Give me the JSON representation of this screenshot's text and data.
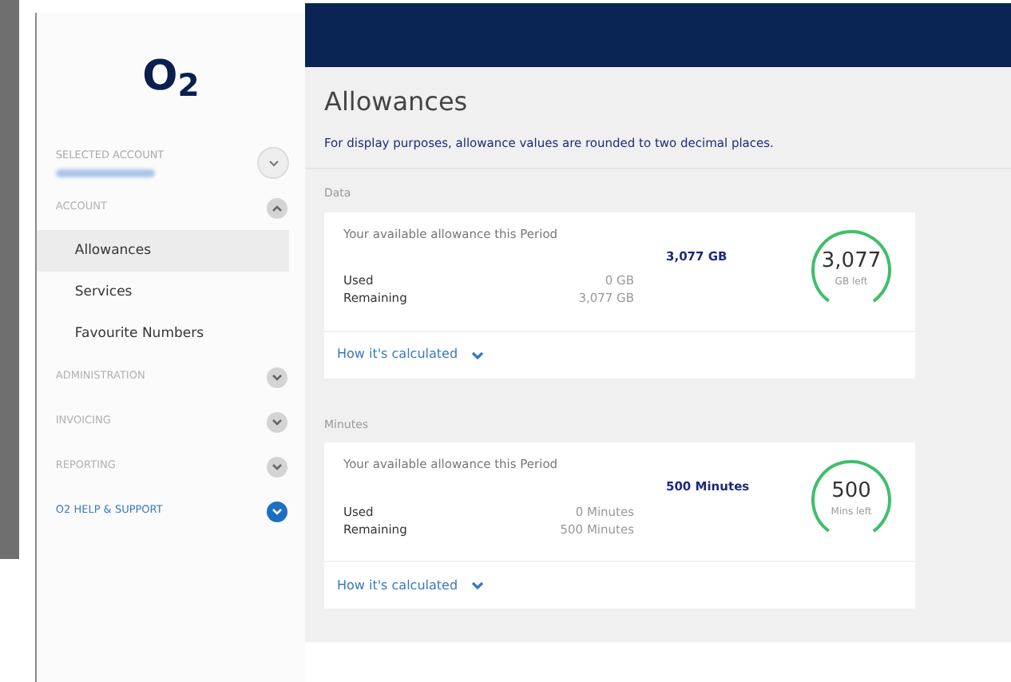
{
  "logo": "O$_{2}$",
  "selected_account": {
    "label": "SELECTED ACCOUNT"
  },
  "sections": [
    {
      "label": "ACCOUNT",
      "expanded": true,
      "kind": "plain",
      "items": [
        {
          "label": "Allowances",
          "selected": true
        },
        {
          "label": "Services",
          "selected": false
        },
        {
          "label": "Favourite Numbers",
          "selected": false
        }
      ]
    },
    {
      "label": "ADMINISTRATION",
      "expanded": false,
      "kind": "plain"
    },
    {
      "label": "INVOICING",
      "expanded": false,
      "kind": "plain"
    },
    {
      "label": "REPORTING",
      "expanded": false,
      "kind": "plain"
    },
    {
      "label": "O2 HELP & SUPPORT",
      "expanded": false,
      "kind": "accent"
    }
  ],
  "page_title": "Allowances",
  "notice": "For display purposes, allowance values are rounded to two decimal places.",
  "allowances": [
    {
      "heading": "Data",
      "caption": "Your available allowance this Period",
      "total": "3,077 GB",
      "used_label": "Used",
      "used": "0 GB",
      "remaining_label": "Remaining",
      "remaining": "3,077 GB",
      "gauge_value": "3,077",
      "gauge_unit": "GB left",
      "level": 1,
      "link": "How it's calculated"
    },
    {
      "heading": "Minutes",
      "caption": "Your available allowance this Period",
      "total": "500 Minutes",
      "used_label": "Used",
      "used": "0 Minutes",
      "remaining_label": "Remaining",
      "remaining": "500 Minutes",
      "gauge_value": "500",
      "gauge_unit": "Mins left",
      "level": 1,
      "link": "How it's calculated"
    }
  ]
}
